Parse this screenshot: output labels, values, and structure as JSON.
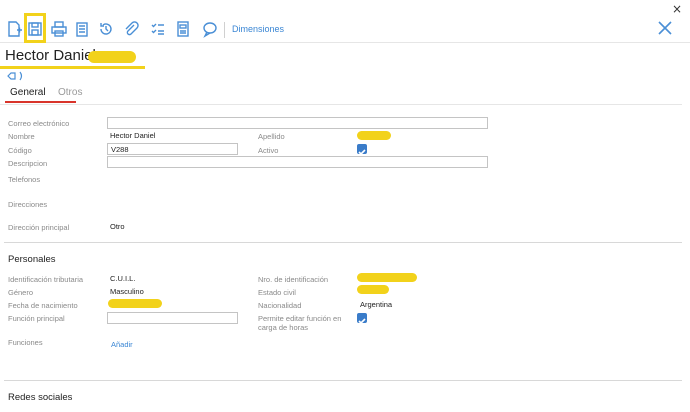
{
  "window": {
    "close_glyph": "×"
  },
  "toolbar": {
    "icons": [
      "new-document-icon",
      "save-icon",
      "print-icon",
      "clipboard-icon",
      "history-icon",
      "attach-icon",
      "checklist-icon",
      "document-icon",
      "comment-icon"
    ],
    "dimensions_link": "Dimensiones",
    "close_icon": "close-icon",
    "accent": "#4a8fd6",
    "highlight": "#f2d21b"
  },
  "record": {
    "title": "Hector Daniel"
  },
  "tabs": [
    {
      "label": "General",
      "active": true
    },
    {
      "label": "Otros",
      "active": false
    }
  ],
  "general": {
    "email_label": "Correo electrónico",
    "email_value": "",
    "name_label": "Nombre",
    "name_value": "Hector Daniel",
    "surname_label": "Apellido",
    "code_label": "Código",
    "code_value": "V288",
    "active_label": "Activo",
    "active_checked": true,
    "description_label": "Descripcion",
    "description_value": "",
    "phones_label": "Telefonos",
    "addresses_label": "Direcciones",
    "main_address_label": "Dirección principal",
    "main_address_value": "Otro"
  },
  "personales": {
    "title": "Personales",
    "tax_id_label": "Identificación tributaria",
    "tax_id_value": "C.U.I.L.",
    "id_number_label": "Nro. de identificación",
    "gender_label": "Género",
    "gender_value": "Masculino",
    "civil_status_label": "Estado civil",
    "birth_date_label": "Fecha de nacimiento",
    "nationality_label": "Nacionalidad",
    "nationality_value": "Argentina",
    "main_function_label": "Función principal",
    "main_function_value": "",
    "edit_function_label_1": "Permite editar función en",
    "edit_function_label_2": "carga de horas",
    "edit_function_checked": true,
    "functions_label": "Funciones",
    "add_link": "Añadir"
  },
  "social": {
    "title": "Redes sociales"
  }
}
